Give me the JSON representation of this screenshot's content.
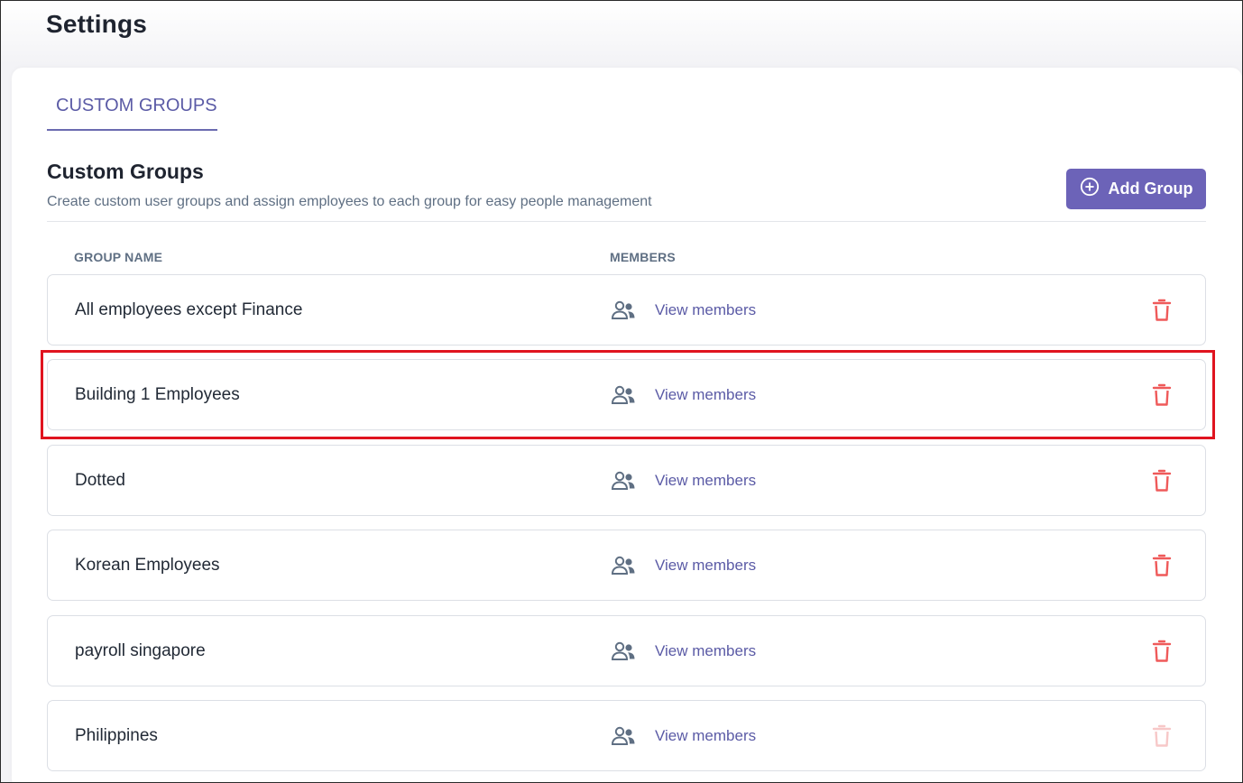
{
  "page": {
    "title": "Settings"
  },
  "tabs": [
    {
      "label": "CUSTOM GROUPS",
      "active": true
    }
  ],
  "section": {
    "title": "Custom Groups",
    "description": "Create custom user groups and assign employees to each group for easy people management",
    "add_button_label": "Add Group"
  },
  "table": {
    "columns": {
      "group_name": "GROUP NAME",
      "members": "MEMBERS"
    },
    "rows": [
      {
        "name": "All employees except Finance",
        "members_link": "View members"
      },
      {
        "name": "Building 1 Employees",
        "members_link": "View members",
        "highlighted": true
      },
      {
        "name": "Dotted",
        "members_link": "View members"
      },
      {
        "name": "Korean Employees",
        "members_link": "View members"
      },
      {
        "name": "payroll singapore",
        "members_link": "View members"
      },
      {
        "name": "Philippines",
        "members_link": "View members",
        "delete_disabled": true
      }
    ]
  },
  "colors": {
    "accent": "#6c63b8",
    "link": "#5b5ba6",
    "delete": "#ef5a5a",
    "delete_disabled": "#f7c8c8",
    "highlight_box": "#e0141f"
  },
  "icons": {
    "add": "plus-circle-icon",
    "members": "users-icon",
    "delete": "trash-icon"
  }
}
